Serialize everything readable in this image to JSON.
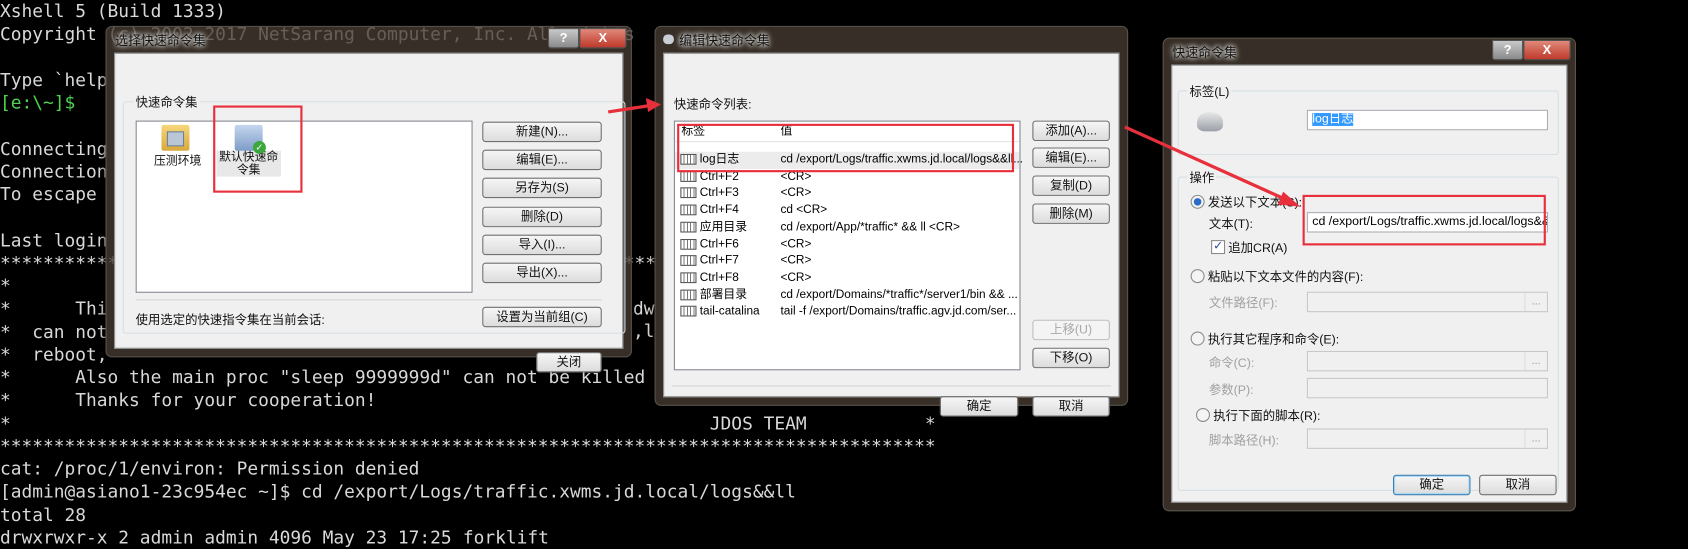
{
  "terminal": {
    "lines": [
      "Xshell 5 (Build 1333)",
      "Copyright (c) 2002-2017 NetSarang Computer, Inc. All rights",
      "",
      "Type `help",
      "[e:\\~]$",
      "",
      "Connecting",
      "Connection",
      "To escape",
      "",
      "Last login",
      "*************************************************************",
      "*",
      "*      Thi",
      "*  can not",
      "*  reboot,",
      "*      Also the main proc \"sleep 9999999d\" can not be killed",
      "*      Thanks for your cooperation!",
      "*                                                                 JDOS TEAM           *",
      "***************************************************************************************",
      "cat: /proc/1/environ: Permission denied",
      "[admin@asiano1-23c954ec ~]$ cd /export/Logs/traffic.xwms.jd.local/logs&&ll",
      "total 28",
      "drwxrwxr-x 2 admin admin 4096 May 23 17:25 "
    ],
    "forklift": "forklift",
    "frag_dw": "dw",
    "frag_l": ",l",
    "colors": {
      "text": "#d9d9d9",
      "prompt": "#4fd34f",
      "dir": "#4a8bff",
      "highlight": "#e8303c"
    }
  },
  "dialog_select": {
    "title": "选择快速命令集",
    "help": "?",
    "close": "X",
    "group_label": "快速命令集",
    "sets": [
      {
        "label": "压测环境",
        "icon": "folder-computers-icon"
      },
      {
        "label": "默认快速命令集",
        "icon": "default-set-check-icon"
      }
    ],
    "buttons": {
      "new": "新建(N)...",
      "edit": "编辑(E)...",
      "save_as": "另存为(S)",
      "delete": "删除(D)",
      "import": "导入(I)...",
      "export": "导出(X)...",
      "set_current": "设置为当前组(C)",
      "close": "关闭"
    },
    "use_label": "使用选定的快速指令集在当前会话:"
  },
  "dialog_edit": {
    "title": "编辑快速命令集",
    "list_label": "快速命令列表:",
    "columns": [
      "标签",
      "值"
    ],
    "rows": [
      {
        "label": "log日志",
        "value": "cd /export/Logs/traffic.xwms.jd.local/logs&&ll..."
      },
      {
        "label": "Ctrl+F2",
        "value": "  <CR>"
      },
      {
        "label": "Ctrl+F3",
        "value": "  <CR>"
      },
      {
        "label": "Ctrl+F4",
        "value": "cd  <CR>"
      },
      {
        "label": "应用目录",
        "value": "cd /export/App/*traffic* && ll <CR>"
      },
      {
        "label": "Ctrl+F6",
        "value": "  <CR>"
      },
      {
        "label": "Ctrl+F7",
        "value": "  <CR>"
      },
      {
        "label": "Ctrl+F8",
        "value": "  <CR>"
      },
      {
        "label": "部署目录",
        "value": "cd /export/Domains/*traffic*/server1/bin && ..."
      },
      {
        "label": "tail-catalina",
        "value": "tail -f /export/Domains/traffic.agv.jd.com/ser..."
      }
    ],
    "buttons": {
      "add": "添加(A)...",
      "edit": "编辑(E)...",
      "copy": "复制(D)",
      "delete": "删除(M)",
      "up": "上移(U)",
      "down": "下移(O)",
      "ok": "确定",
      "cancel": "取消"
    }
  },
  "dialog_command": {
    "title": "快速命令集",
    "help": "?",
    "close": "X",
    "label_group": "标签(L)",
    "label_value": "log日志",
    "action_group": "操作",
    "send_text_option": "发送以下文本(S):",
    "text_label": "文本(T):",
    "text_value": "cd /export/Logs/traffic.xwms.jd.local/logs&&ll",
    "append_cr": "追加CR(A)",
    "append_cr_checked": true,
    "paste_file_option": "粘贴以下文本文件的内容(F):",
    "file_path_label": "文件路径(F):",
    "run_program_option": "执行其它程序和命令(E):",
    "command_label": "命令(C):",
    "args_label": "参数(P):",
    "run_script_option": "执行下面的脚本(R):",
    "script_path_label": "脚本路径(H):",
    "browse": "...",
    "selected_option": "send_text",
    "ok": "确定",
    "cancel": "取消"
  }
}
